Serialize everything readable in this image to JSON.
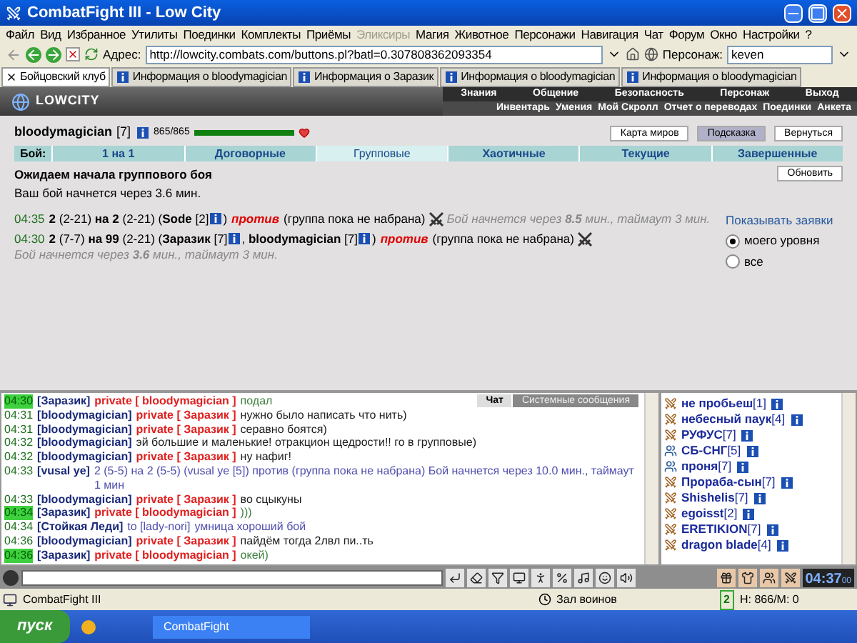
{
  "window": {
    "title": "CombatFight III - Low City"
  },
  "menu": [
    {
      "label": "Файл",
      "disabled": false
    },
    {
      "label": "Вид",
      "disabled": false
    },
    {
      "label": "Избранное",
      "disabled": false
    },
    {
      "label": "Утилиты",
      "disabled": false
    },
    {
      "label": "Поединки",
      "disabled": false
    },
    {
      "label": "Комплекты",
      "disabled": false
    },
    {
      "label": "Приёмы",
      "disabled": false
    },
    {
      "label": "Эликсиры",
      "disabled": true
    },
    {
      "label": "Магия",
      "disabled": false
    },
    {
      "label": "Животное",
      "disabled": false
    },
    {
      "label": "Персонажи",
      "disabled": false
    },
    {
      "label": "Навигация",
      "disabled": false
    },
    {
      "label": "Чат",
      "disabled": false
    },
    {
      "label": "Форум",
      "disabled": false
    },
    {
      "label": "Окно",
      "disabled": false
    },
    {
      "label": "Настройки",
      "disabled": false
    },
    {
      "label": "?",
      "disabled": false
    }
  ],
  "address_bar": {
    "label": "Адрес:",
    "url": "http://lowcity.combats.com/buttons.pl?batl=0.307808362093354",
    "persona_label": "Персонаж:",
    "persona": "keven"
  },
  "tabs": [
    {
      "label": "Бойцовский клуб",
      "selected": true
    },
    {
      "label": "Информация о bloodymagician",
      "selected": false
    },
    {
      "label": "Информация о Заразик",
      "selected": false
    },
    {
      "label": "Информация о bloodymagician",
      "selected": false
    },
    {
      "label": "Информация о bloodymagician",
      "selected": false
    }
  ],
  "game_header": {
    "logo": "LOWCITY",
    "nav_top": [
      "Знания",
      "Общение",
      "Безопасность",
      "Персонаж",
      "Выход"
    ],
    "nav_bottom": [
      "Инвентарь",
      "Умения",
      "Мой Скролл",
      "Отчет о переводах",
      "Поединки",
      "Анкета"
    ]
  },
  "player": {
    "name": "bloodymagician",
    "level_label": "[7]",
    "hp": "865/865",
    "level": 1
  },
  "top_buttons": [
    {
      "label": "Карта миров",
      "selected": false
    },
    {
      "label": "Подсказка",
      "selected": true
    },
    {
      "label": "Вернуться",
      "selected": false
    }
  ],
  "fight_tabs": {
    "label": "Бой:",
    "items": [
      {
        "label": "1 на 1",
        "selected": false
      },
      {
        "label": "Договорные",
        "selected": false
      },
      {
        "label": "Групповые",
        "selected": true
      },
      {
        "label": "Хаотичные",
        "selected": false
      },
      {
        "label": "Текущие",
        "selected": false
      },
      {
        "label": "Завершенные",
        "selected": false
      }
    ]
  },
  "status": {
    "title": "Ожидаем начала группового боя",
    "subtitle": "Ваш бой начнется через 3.6 мин.",
    "refresh": "Обновить"
  },
  "requests": [
    {
      "time": "04:35",
      "parts": [
        {
          "kind": "text",
          "text": "**2** (2-21) **на 2** (2-21) (**Sode** [2]"
        },
        {
          "kind": "info"
        },
        {
          "kind": "text",
          "text": ")"
        },
        {
          "kind": "against",
          "text": "против"
        },
        {
          "kind": "text",
          "text": "(группа пока не набрана)"
        },
        {
          "kind": "battle"
        },
        {
          "kind": "note",
          "text": "Бой начнется через **8.5** мин., таймаут 3 мин."
        }
      ]
    },
    {
      "time": "04:30",
      "parts": [
        {
          "kind": "text",
          "text": "**2** (7-7) **на 99** (2-21) (**Заразик** [7]"
        },
        {
          "kind": "info"
        },
        {
          "kind": "text",
          "text": ", **bloodymagician** [7]"
        },
        {
          "kind": "info"
        },
        {
          "kind": "text",
          "text": ")"
        },
        {
          "kind": "against",
          "text": "против"
        },
        {
          "kind": "text",
          "text": "(группа пока не набрана)"
        },
        {
          "kind": "battle"
        },
        {
          "kind": "note",
          "text": "Бой начнется через **3.6** мин., таймаут 3 мин."
        }
      ]
    }
  ],
  "filter": {
    "title": "Показывать заявки",
    "options": [
      {
        "label": "моего уровня",
        "selected": true
      },
      {
        "label": "все",
        "selected": false
      }
    ]
  },
  "chat_tabs": [
    {
      "label": "Чат",
      "selected": true
    },
    {
      "label": "Системные сообщения",
      "selected": false
    }
  ],
  "chat": [
    {
      "time": "04:30",
      "highlighted": true,
      "sender": "[Заразик]",
      "kind": "private",
      "tag": "private [ bloodymagician ]",
      "text": "подал",
      "color": "#408040"
    },
    {
      "time": "04:31",
      "highlighted": false,
      "sender": "[bloodymagician]",
      "kind": "private",
      "tag": "private [ Заразик ]",
      "text": "нужно было написать что нить)",
      "color": "#202020"
    },
    {
      "time": "04:31",
      "highlighted": false,
      "sender": "[bloodymagician]",
      "kind": "private",
      "tag": "private [ Заразик ]",
      "text": "серавно боятся)",
      "color": "#202020"
    },
    {
      "time": "04:32",
      "highlighted": false,
      "sender": "[bloodymagician]",
      "kind": "public",
      "text": "эй большие и маленькие! отракцион щедрости!! го в групповые)",
      "color": "#202020"
    },
    {
      "time": "04:32",
      "highlighted": false,
      "sender": "[bloodymagician]",
      "kind": "private",
      "tag": "private [ Заразик ]",
      "text": "ну нафиг!",
      "color": "#202020"
    },
    {
      "time": "04:33",
      "highlighted": false,
      "sender": "[vusal ye]",
      "kind": "public",
      "text": "2 (5-5) на 2 (5-5) (vusal ye [5]) против (группа пока не набрана) Бой начнется через 10.0 мин., таймаут 1 мин",
      "color": "#5050b0"
    },
    {
      "time": "04:33",
      "highlighted": false,
      "sender": "[bloodymagician]",
      "kind": "private",
      "tag": "private [ Заразик ]",
      "text": "во сцыкуны",
      "color": "#202020"
    },
    {
      "time": "04:34",
      "highlighted": true,
      "sender": "[Заразик]",
      "kind": "private",
      "tag": "private [ bloodymagician ]",
      "text": ")))",
      "color": "#408040"
    },
    {
      "time": "04:34",
      "highlighted": false,
      "sender": "[Стойкая Леди]",
      "kind": "to",
      "tag": "to [lady-nori]",
      "text": "умница хороший бой",
      "color": "#5050b0"
    },
    {
      "time": "04:36",
      "highlighted": false,
      "sender": "[bloodymagician]",
      "kind": "private",
      "tag": "private [ Заразик ]",
      "text": "пайдём тогда 2лвл пи..ть",
      "color": "#202020"
    },
    {
      "time": "04:36",
      "highlighted": true,
      "sender": "[Заразик]",
      "kind": "private",
      "tag": "private [ bloodymagician ]",
      "text": "окей)",
      "color": "#408040"
    }
  ],
  "users": [
    {
      "name": "не пробьеш",
      "level": "[1]",
      "kind": "fighter"
    },
    {
      "name": "небесный паук",
      "level": "[4]",
      "kind": "fighter"
    },
    {
      "name": "РУФУС",
      "level": "[7]",
      "kind": "fighter"
    },
    {
      "name": "СБ-СНГ",
      "level": "[5]",
      "kind": "guard"
    },
    {
      "name": "проня",
      "level": "[7]",
      "kind": "guard"
    },
    {
      "name": "Прораба-сын",
      "level": "[7]",
      "kind": "fighter"
    },
    {
      "name": "Shishelis",
      "level": "[7]",
      "kind": "fighter"
    },
    {
      "name": "egoisst",
      "level": "[2]",
      "kind": "fighter"
    },
    {
      "name": "ERETIKION",
      "level": "[7]",
      "kind": "fighter"
    },
    {
      "name": "dragon blade",
      "level": "[4]",
      "kind": "fighter"
    }
  ],
  "clock": {
    "time": "04:37",
    "seconds": "00"
  },
  "status_bar": {
    "app": "CombatFight III",
    "location": "Зал воинов",
    "counter": "2",
    "stats": "Н: 866/М: 0"
  },
  "taskbar": {
    "start": "пуск",
    "task": "CombatFight"
  }
}
